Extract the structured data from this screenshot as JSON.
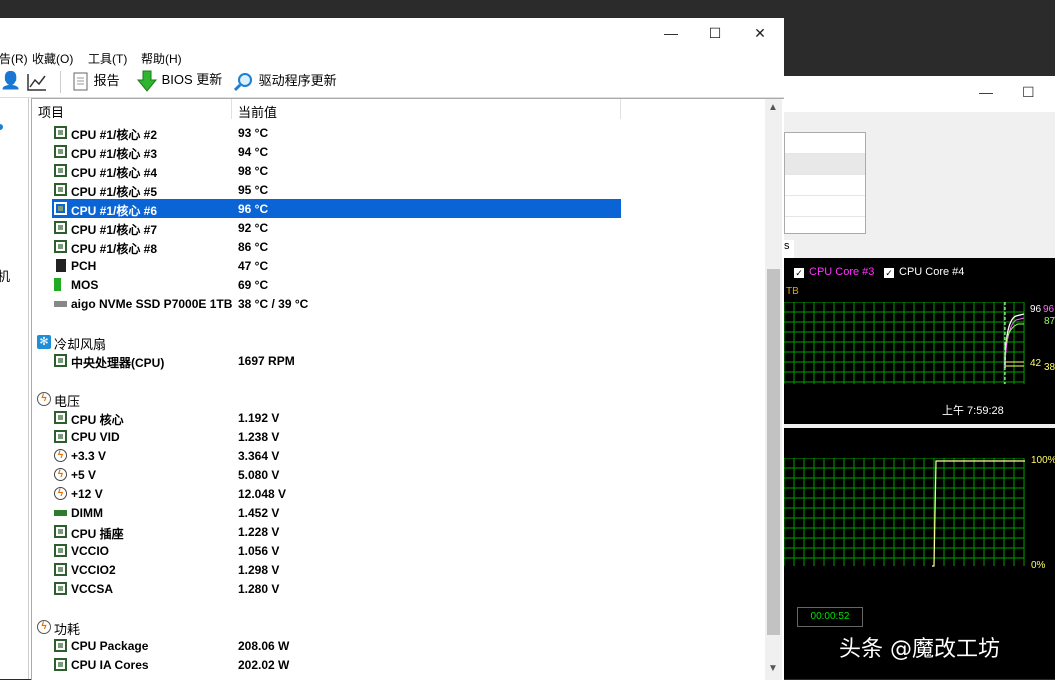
{
  "main_window": {
    "menu": [
      "告(R)",
      "收藏(O)",
      "工具(T)",
      "帮助(H)"
    ],
    "toolbar": {
      "report": "报告",
      "bios_update": "BIOS 更新",
      "driver_update": "驱动程序更新"
    },
    "left_pane_text": "机",
    "columns": {
      "item": "项目",
      "value": "当前值"
    },
    "temperature_rows": [
      {
        "label": "CPU #1/核心 #2",
        "value": "93 °C"
      },
      {
        "label": "CPU #1/核心 #3",
        "value": "94 °C"
      },
      {
        "label": "CPU #1/核心 #4",
        "value": "98 °C"
      },
      {
        "label": "CPU #1/核心 #5",
        "value": "95 °C"
      },
      {
        "label": "CPU #1/核心 #6",
        "value": "96 °C"
      },
      {
        "label": "CPU #1/核心 #7",
        "value": "92 °C"
      },
      {
        "label": "CPU #1/核心 #8",
        "value": "86 °C"
      },
      {
        "label": "PCH",
        "value": "47 °C"
      },
      {
        "label": "MOS",
        "value": "69 °C"
      },
      {
        "label": "aigo NVMe SSD P7000E 1TB",
        "value": "38 °C / 39 °C"
      }
    ],
    "fan_group": {
      "title": "冷却风扇",
      "rows": [
        {
          "label": "中央处理器(CPU)",
          "value": "1697 RPM"
        }
      ]
    },
    "voltage_group": {
      "title": "电压",
      "rows": [
        {
          "label": "CPU 核心",
          "value": "1.192 V"
        },
        {
          "label": "CPU VID",
          "value": "1.238 V"
        },
        {
          "label": "+3.3 V",
          "value": "3.364 V"
        },
        {
          "label": "+5 V",
          "value": "5.080 V"
        },
        {
          "label": "+12 V",
          "value": "12.048 V"
        },
        {
          "label": "DIMM",
          "value": "1.452 V"
        },
        {
          "label": "CPU 插座",
          "value": "1.228 V"
        },
        {
          "label": "VCCIO",
          "value": "1.056 V"
        },
        {
          "label": "VCCIO2",
          "value": "1.298 V"
        },
        {
          "label": "VCCSA",
          "value": "1.280 V"
        }
      ]
    },
    "power_group": {
      "title": "功耗",
      "rows": [
        {
          "label": "CPU Package",
          "value": "208.06 W"
        },
        {
          "label": "CPU IA Cores",
          "value": "202.02 W"
        }
      ]
    }
  },
  "background_window": {
    "tab_fragment": "s",
    "legend": [
      {
        "label": "CPU Core #3",
        "color": "#ff33ff"
      },
      {
        "label": "CPU Core #4",
        "color": "#ffffff"
      }
    ],
    "graph1": {
      "unit_fragment": "TB",
      "readings": [
        "96",
        "96",
        "87",
        "42",
        "38"
      ],
      "time": "上午 7:59:28"
    },
    "graph2": {
      "top_label": "100%",
      "bottom_label": "0%"
    },
    "elapsed": "00:00:52"
  },
  "watermark": "头条 @魔改工坊",
  "colors": {
    "selection": "#0a64d6",
    "grid": "#00a000",
    "graph_bg": "#000000"
  }
}
